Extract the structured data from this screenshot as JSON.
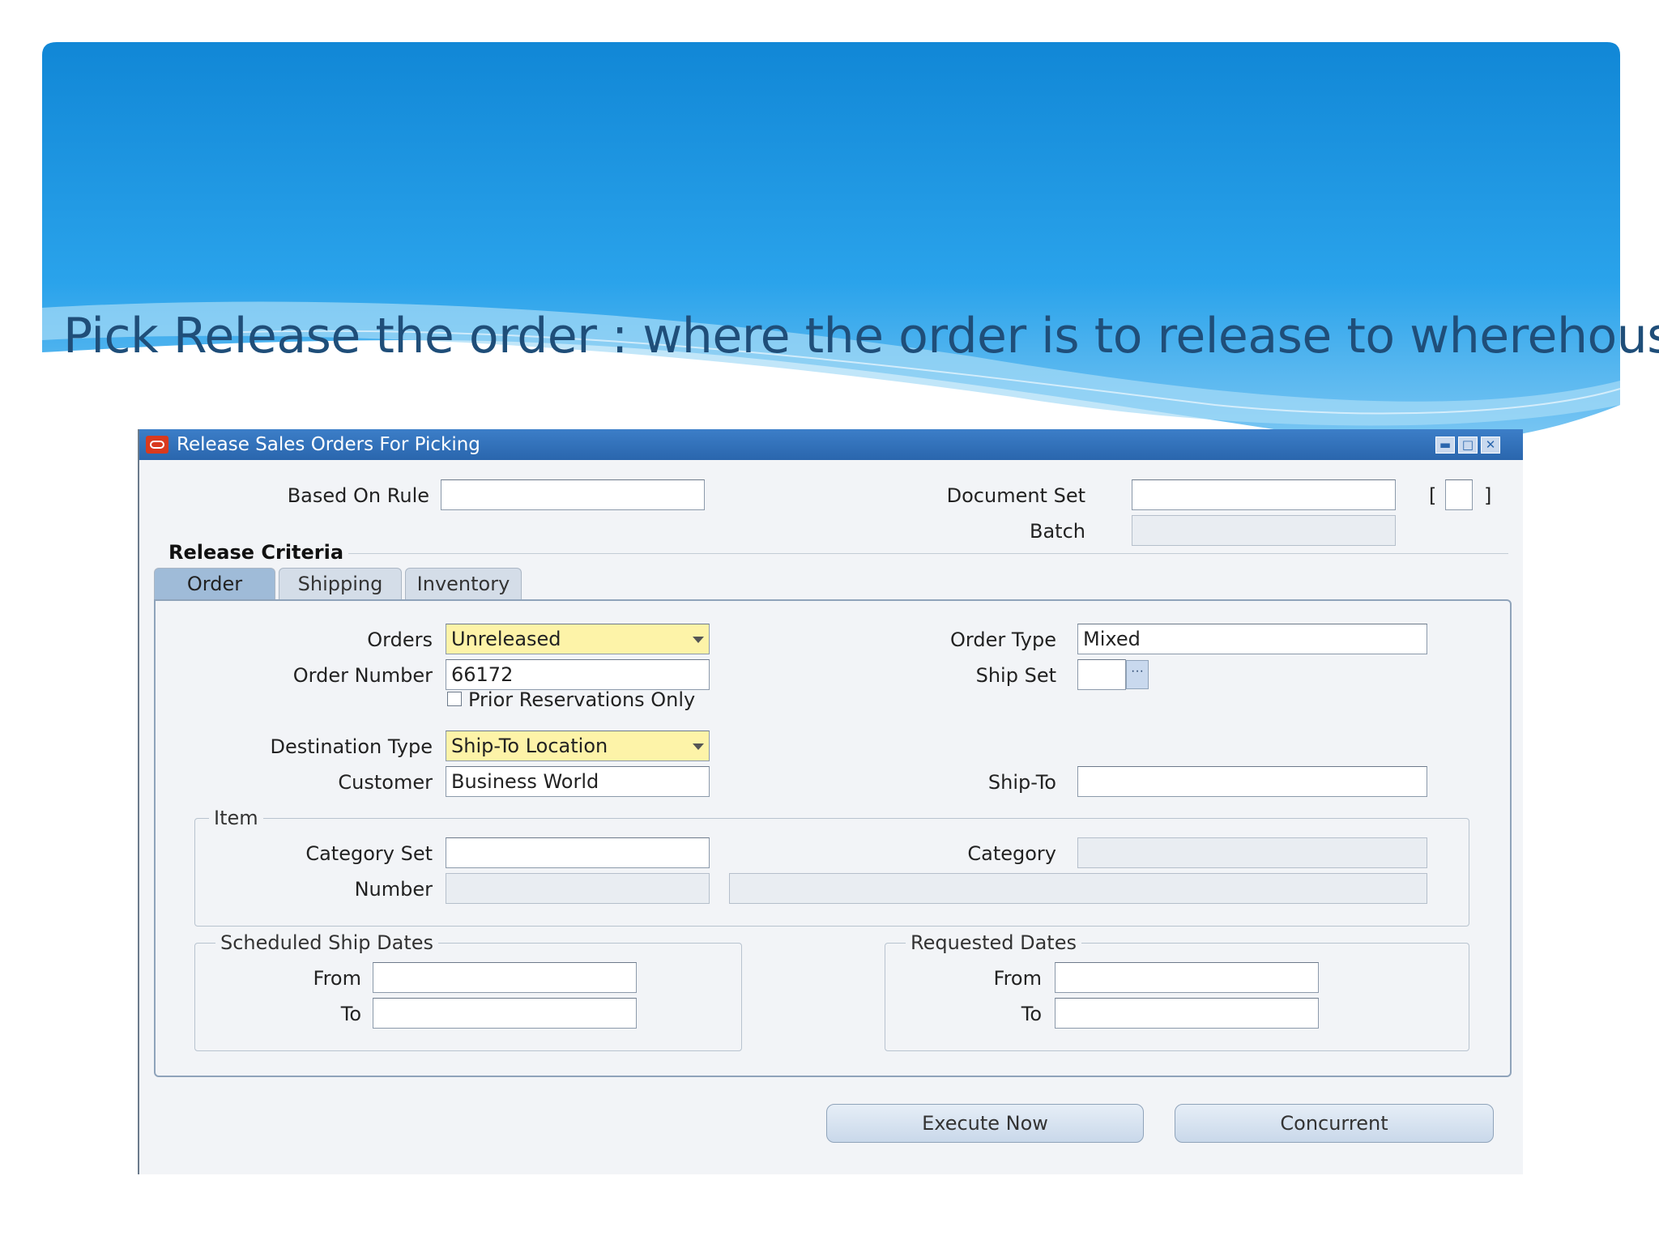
{
  "slide": {
    "title": "Pick Release the order : where the order is to release to wherehouse"
  },
  "window": {
    "title": "Release Sales Orders For Picking",
    "controls": {
      "minimize": "▬",
      "maximize": "□",
      "close": "✕"
    }
  },
  "header": {
    "based_on_rule_label": "Based On Rule",
    "based_on_rule_value": "",
    "document_set_label": "Document Set",
    "document_set_value": "",
    "batch_label": "Batch",
    "batch_value": "",
    "bracket_left": "[",
    "bracket_right": "]"
  },
  "release_criteria": {
    "label": "Release Criteria",
    "tabs": [
      "Order",
      "Shipping",
      "Inventory"
    ],
    "active_tab": "Order"
  },
  "order_tab": {
    "orders_label": "Orders",
    "orders_value": "Unreleased",
    "order_number_label": "Order Number",
    "order_number_value": "66172",
    "prior_reservations_label": "Prior Reservations Only",
    "prior_reservations_checked": false,
    "destination_type_label": "Destination Type",
    "destination_type_value": "Ship-To Location",
    "customer_label": "Customer",
    "customer_value": "Business World",
    "order_type_label": "Order Type",
    "order_type_value": "Mixed",
    "ship_set_label": "Ship Set",
    "ship_set_value": "",
    "ship_set_lov": "···",
    "ship_to_label": "Ship-To",
    "ship_to_value": ""
  },
  "item_group": {
    "label": "Item",
    "category_set_label": "Category Set",
    "category_set_value": "",
    "category_label": "Category",
    "category_value": "",
    "number_label": "Number",
    "number_value": "",
    "description_value": ""
  },
  "scheduled_ship_dates": {
    "label": "Scheduled Ship Dates",
    "from_label": "From",
    "from_value": "",
    "to_label": "To",
    "to_value": ""
  },
  "requested_dates": {
    "label": "Requested Dates",
    "from_label": "From",
    "from_value": "",
    "to_label": "To",
    "to_value": ""
  },
  "actions": {
    "execute_now": "Execute Now",
    "concurrent": "Concurrent"
  },
  "colors": {
    "banner_blue": "#1a9ae0",
    "title_text": "#1f4e79",
    "titlebar": "#2a66ad",
    "required_field": "#fdf3a8"
  }
}
